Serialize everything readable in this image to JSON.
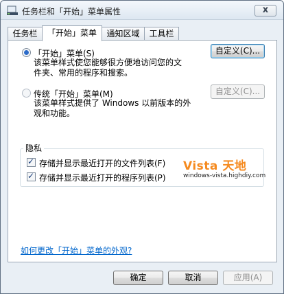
{
  "window": {
    "title": "任务栏和「开始」菜单属性",
    "close_glyph": "x"
  },
  "tabs": [
    {
      "label": "任务栏",
      "active": false
    },
    {
      "label": "「开始」菜单",
      "active": true
    },
    {
      "label": "通知区域",
      "active": false
    },
    {
      "label": "工具栏",
      "active": false
    }
  ],
  "options": {
    "start_menu": {
      "label": "「开始」菜单(S)",
      "selected": true,
      "description_line1": "该菜单样式使您能够很方便地访问您的文",
      "description_line2": "件夹、常用的程序和搜索。",
      "customize_label": "自定义(C)..."
    },
    "classic_menu": {
      "label": "传统「开始」菜单(M)",
      "selected": false,
      "description_line1": "该菜单样式提供了 Windows 以前版本的外",
      "description_line2": "观和功能。",
      "customize_label": "自定义(C)..."
    }
  },
  "privacy": {
    "title": "隐私",
    "recent_files": {
      "label": "存储并显示最近打开的文件列表(F)",
      "checked": true
    },
    "recent_programs": {
      "label": "存储并显示最近打开的程序列表(P)",
      "checked": true
    }
  },
  "watermark": {
    "title": "Vista 天地",
    "url": "windows-vista.highdiy.com"
  },
  "help_link": "如何更改「开始」菜单的外观?",
  "footer": {
    "ok_label": "确定",
    "cancel_label": "取消",
    "apply_label": "应用(A)"
  },
  "colors": {
    "accent": "#2d6cc9",
    "link": "#0066cc",
    "watermark": "#f58a1f"
  }
}
